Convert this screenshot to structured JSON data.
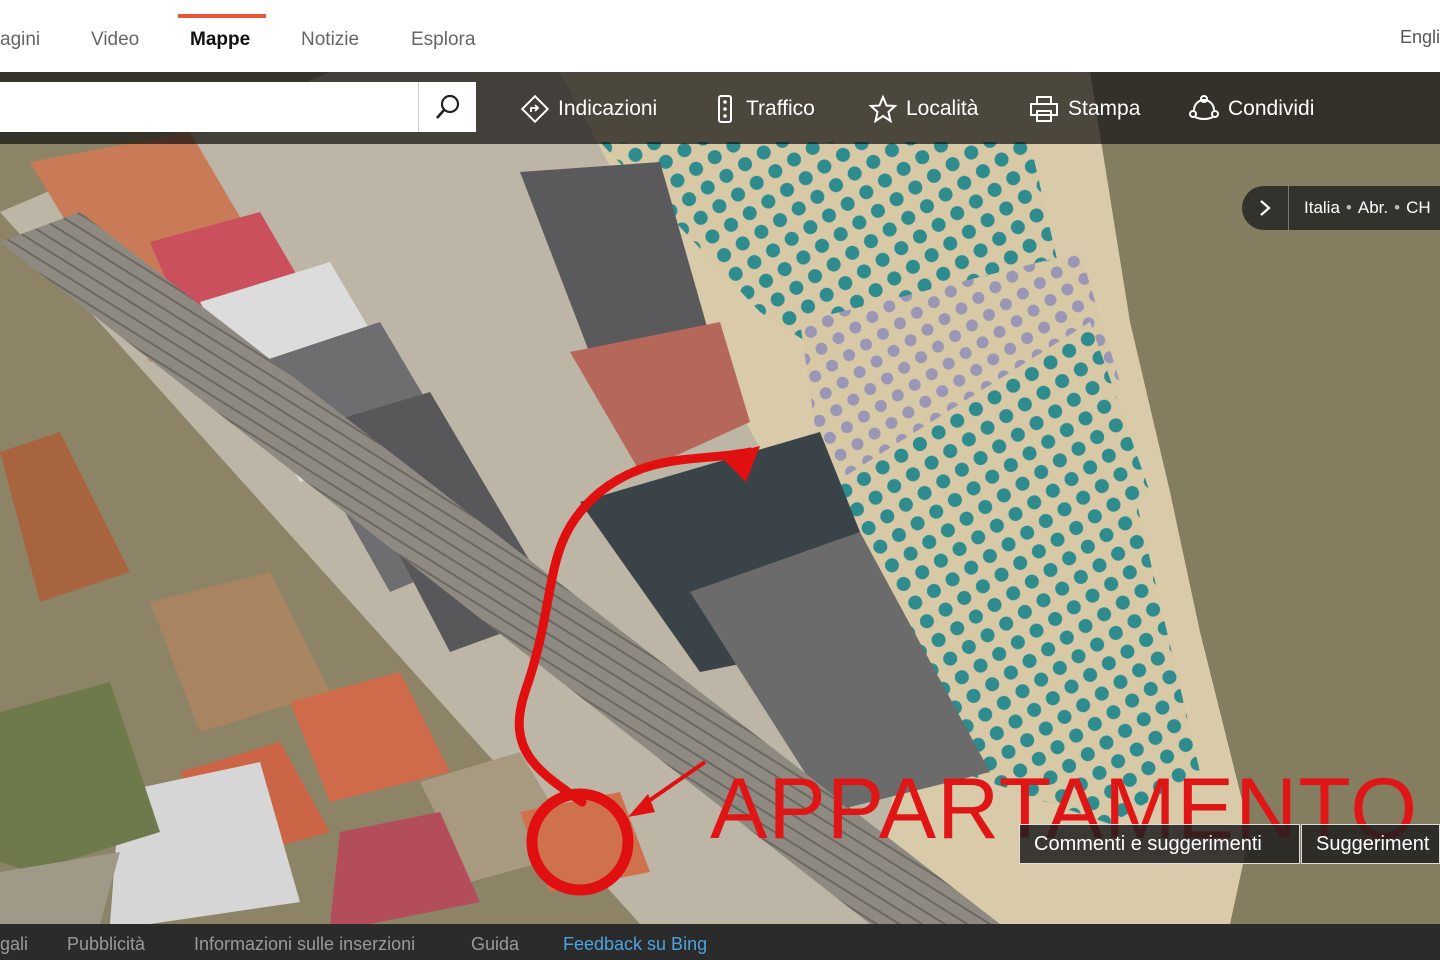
{
  "nav": {
    "tabs": [
      {
        "label": "agini",
        "active": false
      },
      {
        "label": "Video",
        "active": false
      },
      {
        "label": "Mappe",
        "active": true
      },
      {
        "label": "Notizie",
        "active": false
      },
      {
        "label": "Esplora",
        "active": false
      }
    ],
    "language": "Engli",
    "accent_color": "#e8563a"
  },
  "toolbar": {
    "search": {
      "value": "",
      "placeholder": "",
      "icon": "search-icon"
    },
    "tools": [
      {
        "label": "Indicazioni",
        "icon": "directions-icon"
      },
      {
        "label": "Traffico",
        "icon": "traffic-icon"
      },
      {
        "label": "Località",
        "icon": "star-icon"
      },
      {
        "label": "Stampa",
        "icon": "print-icon"
      },
      {
        "label": "Condividi",
        "icon": "share-icon"
      }
    ]
  },
  "breadcrumb": {
    "icon": "chevron-right-icon",
    "items": [
      "Italia",
      "Abr.",
      "CH"
    ]
  },
  "annotation": {
    "text": "APPARTAMENTO",
    "color": "#e01515"
  },
  "feedback": {
    "comments_label": "Commenti e suggerimenti",
    "suggestions_label": "Suggeriment"
  },
  "footer": {
    "links": [
      {
        "label": "gali"
      },
      {
        "label": "Pubblicità"
      },
      {
        "label": "Informazioni sulle inserzioni"
      },
      {
        "label": "Guida"
      },
      {
        "label": "Feedback su Bing",
        "accent": true
      }
    ]
  }
}
